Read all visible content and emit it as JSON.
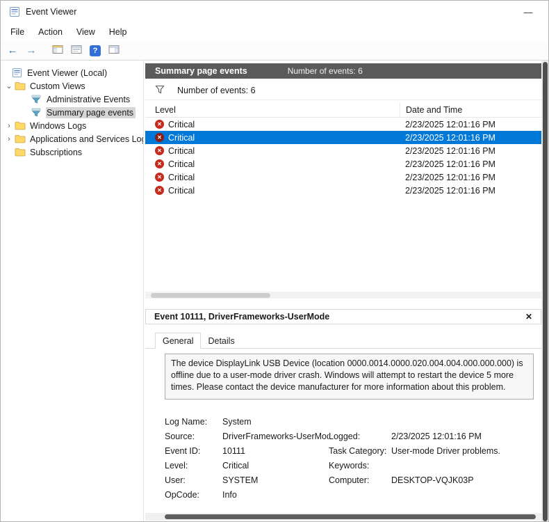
{
  "colors": {
    "selection": "#0078d7",
    "critical_red": "#c42b1c",
    "summary_header_bg": "#5a5a5a"
  },
  "icons": {
    "minimize": "—",
    "close": "✕",
    "critical_x": "✕",
    "back_arrow": "←",
    "forward_arrow": "→",
    "help": "?",
    "chevron_down": "⌄",
    "chevron_right": "›"
  },
  "window": {
    "title": "Event Viewer"
  },
  "menubar": {
    "items": [
      "File",
      "Action",
      "View",
      "Help"
    ]
  },
  "tree": {
    "items": [
      {
        "label": "Event Viewer (Local)"
      },
      {
        "label": "Custom Views"
      },
      {
        "label": "Administrative Events"
      },
      {
        "label": "Summary page events"
      },
      {
        "label": "Windows Logs"
      },
      {
        "label": "Applications and Services Log"
      },
      {
        "label": "Subscriptions"
      }
    ]
  },
  "summary": {
    "header_title": "Summary page events",
    "header_count": "Number of events: 6",
    "filter_count": "Number of events: 6",
    "columns": {
      "level": "Level",
      "datetime": "Date and Time"
    },
    "selected_row_index": 1,
    "rows": [
      {
        "level": "Critical",
        "datetime": "2/23/2025 12:01:16 PM"
      },
      {
        "level": "Critical",
        "datetime": "2/23/2025 12:01:16 PM"
      },
      {
        "level": "Critical",
        "datetime": "2/23/2025 12:01:16 PM"
      },
      {
        "level": "Critical",
        "datetime": "2/23/2025 12:01:16 PM"
      },
      {
        "level": "Critical",
        "datetime": "2/23/2025 12:01:16 PM"
      },
      {
        "level": "Critical",
        "datetime": "2/23/2025 12:01:16 PM"
      }
    ]
  },
  "detail": {
    "title": "Event 10111, DriverFrameworks-UserMode",
    "tabs": [
      {
        "label": "General"
      },
      {
        "label": "Details"
      }
    ],
    "description": "The device DisplayLink USB Device (location 0000.0014.0000.020.004.004.000.000.000) is offline due to a user-mode driver crash.  Windows will attempt to restart the device 5 more times.  Please contact the device manufacturer for more information about this problem.",
    "fields": [
      {
        "label": "Log Name:",
        "value": "System",
        "label2": "",
        "value2": ""
      },
      {
        "label": "Source:",
        "value": "DriverFrameworks-UserMode",
        "label2": "Logged:",
        "value2": "2/23/2025 12:01:16 PM"
      },
      {
        "label": "Event ID:",
        "value": "10111",
        "label2": "Task Category:",
        "value2": "User-mode Driver problems."
      },
      {
        "label": "Level:",
        "value": "Critical",
        "label2": "Keywords:",
        "value2": ""
      },
      {
        "label": "User:",
        "value": "SYSTEM",
        "label2": "Computer:",
        "value2": "DESKTOP-VQJK03P"
      },
      {
        "label": "OpCode:",
        "value": "Info",
        "label2": "",
        "value2": ""
      }
    ]
  }
}
